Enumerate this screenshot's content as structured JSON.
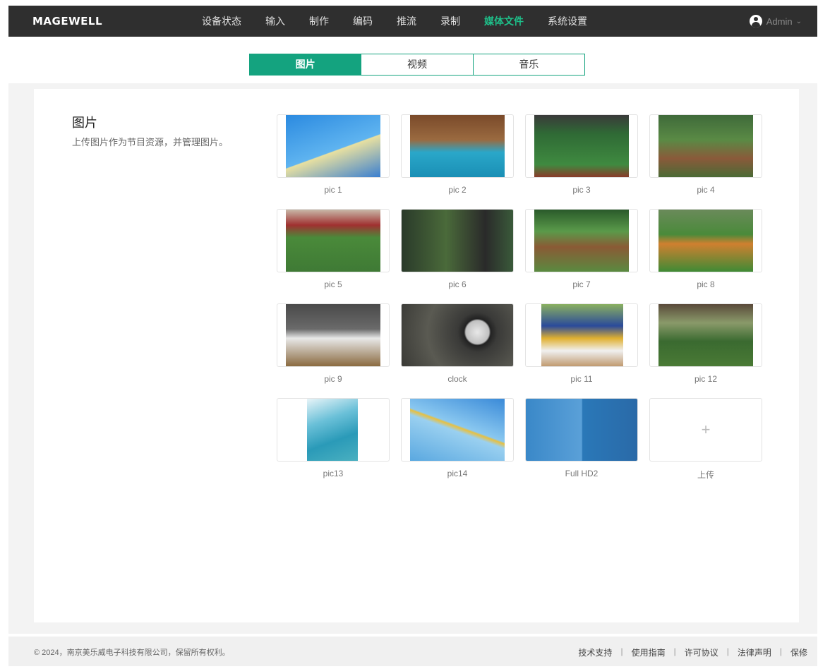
{
  "header": {
    "logo": "MAGEWELL",
    "nav": [
      {
        "label": "设备状态",
        "active": false
      },
      {
        "label": "输入",
        "active": false
      },
      {
        "label": "制作",
        "active": false
      },
      {
        "label": "编码",
        "active": false
      },
      {
        "label": "推流",
        "active": false
      },
      {
        "label": "录制",
        "active": false
      },
      {
        "label": "媒体文件",
        "active": true
      },
      {
        "label": "系统设置",
        "active": false
      }
    ],
    "user": "Admin",
    "accent_color": "#1ec08a"
  },
  "tabs": [
    {
      "label": "图片",
      "active": true
    },
    {
      "label": "视频",
      "active": false
    },
    {
      "label": "音乐",
      "active": false
    }
  ],
  "section": {
    "title": "图片",
    "description": "上传图片作为节目资源，并管理图片。"
  },
  "pictures": [
    {
      "name": "pic 1"
    },
    {
      "name": "pic 2"
    },
    {
      "name": "pic 3"
    },
    {
      "name": "pic 4"
    },
    {
      "name": "pic 5"
    },
    {
      "name": "pic 6"
    },
    {
      "name": "pic 7"
    },
    {
      "name": "pic 8"
    },
    {
      "name": "pic 9"
    },
    {
      "name": "clock"
    },
    {
      "name": "pic 11"
    },
    {
      "name": "pic 12"
    },
    {
      "name": "pic13"
    },
    {
      "name": "pic14"
    },
    {
      "name": "Full HD2"
    }
  ],
  "upload": {
    "label": "上传",
    "icon": "plus-icon"
  },
  "footer": {
    "copyright": "© 2024，南京美乐威电子科技有限公司，保留所有权利。",
    "links": [
      "技术支持",
      "使用指南",
      "许可协议",
      "法律声明",
      "保修"
    ]
  }
}
